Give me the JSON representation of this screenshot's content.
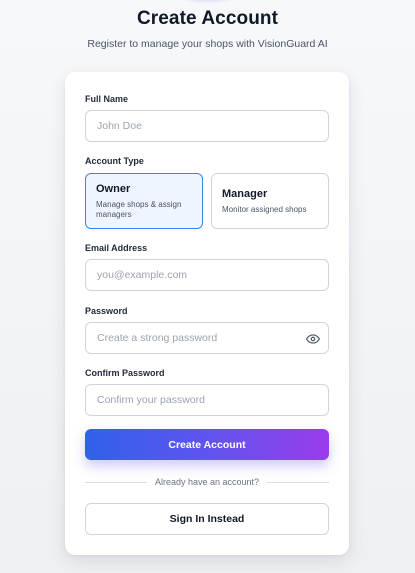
{
  "header": {
    "title": "Create Account",
    "subtitle": "Register to manage your shops with VisionGuard AI"
  },
  "form": {
    "full_name": {
      "label": "Full Name",
      "placeholder": "John Doe"
    },
    "account_type": {
      "label": "Account Type",
      "selected": "Owner",
      "options": [
        {
          "title": "Owner",
          "description": "Manage shops & assign managers"
        },
        {
          "title": "Manager",
          "description": "Monitor assigned shops"
        }
      ]
    },
    "email": {
      "label": "Email Address",
      "placeholder": "you@example.com"
    },
    "password": {
      "label": "Password",
      "placeholder": "Create a strong password",
      "toggle_icon": "eye-icon"
    },
    "confirm_password": {
      "label": "Confirm Password",
      "placeholder": "Confirm your password"
    },
    "submit_label": "Create Account",
    "divider_text": "Already have an account?",
    "signin_label": "Sign In Instead"
  },
  "colors": {
    "accent": "#3b82f6",
    "gradient_start": "#2f62e9",
    "gradient_end": "#9a3cea"
  }
}
